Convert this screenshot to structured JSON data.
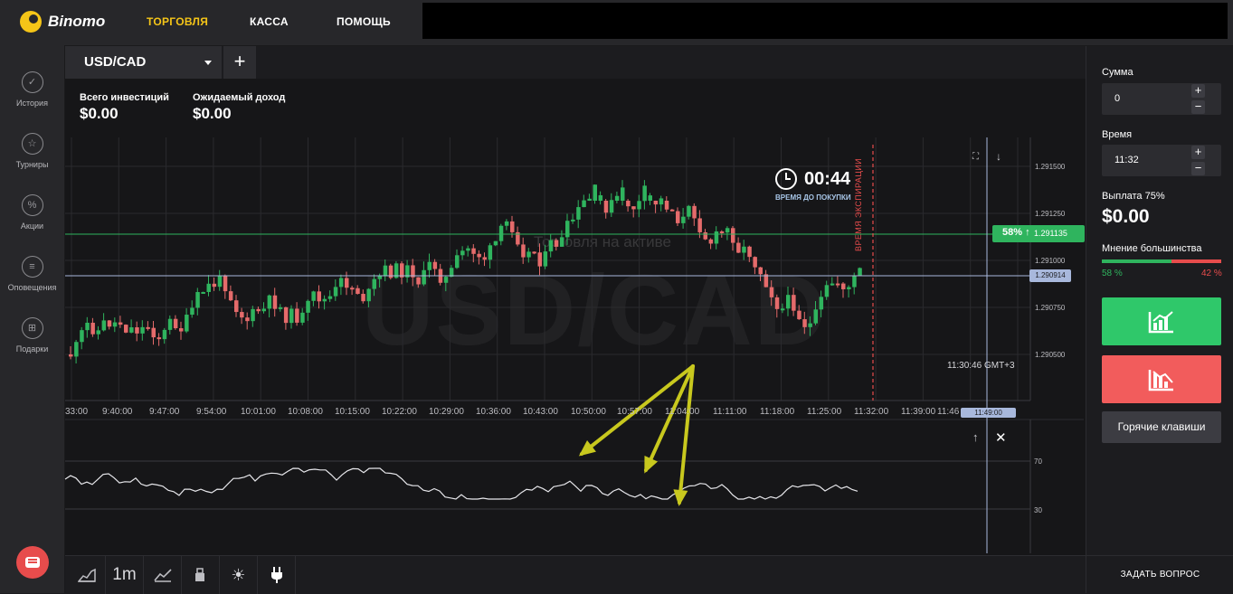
{
  "app": {
    "brand": "Binomo"
  },
  "nav": {
    "trade": "ТОРГОВЛЯ",
    "cash": "КАССА",
    "help": "ПОМОЩЬ"
  },
  "sidebar": {
    "items": [
      {
        "label": "История",
        "icon": "check-circle-icon"
      },
      {
        "label": "Турниры",
        "icon": "trophy-icon"
      },
      {
        "label": "Акции",
        "icon": "percent-icon"
      },
      {
        "label": "Оповещения",
        "icon": "list-icon"
      },
      {
        "label": "Подарки",
        "icon": "gift-icon"
      }
    ]
  },
  "tab": {
    "asset": "USD/CAD",
    "add": "+"
  },
  "stats": {
    "invest_label": "Всего инвестиций",
    "invest_value": "$0.00",
    "income_label": "Ожидаемый доход",
    "income_value": "$0.00"
  },
  "chart": {
    "timer": "00:44",
    "timer_label": "ВРЕМЯ ДО ПОКУПКИ",
    "expiry_label": "ВРЕМЯ ЭКСПИРАЦИИ",
    "watermark": "USD/CAD",
    "watermark_sub": "Торговля на активе",
    "percent_badge": "58% ↑",
    "percent_price": "1.291135",
    "current_price": "1.290914",
    "time_badge": "11:49:00",
    "clock": "11:30:46 GMT+3",
    "price_ticks": [
      "1.291500",
      "1.291250",
      "1.291000",
      "1.290750",
      "1.290500"
    ],
    "time_ticks": [
      "33:00",
      "9:40:00",
      "9:47:00",
      "9:54:00",
      "10:01:00",
      "10:08:00",
      "10:15:00",
      "10:22:00",
      "10:29:00",
      "10:36:00",
      "10:43:00",
      "10:50:00",
      "10:57:00",
      "11:04:00",
      "11:11:00",
      "11:18:00",
      "11:25:00",
      "11:32:00",
      "11:39:00",
      "11:46"
    ],
    "osc_ticks": [
      "70",
      "30"
    ],
    "colors": {
      "up": "#2fb45e",
      "down": "#e56b6b",
      "arrow": "#c8c81e"
    }
  },
  "toolbar": {
    "timeframe": "1m"
  },
  "panel": {
    "amount_label": "Сумма",
    "amount_value": "0",
    "time_label": "Время",
    "time_value": "11:32",
    "payout_label": "Выплата 75%",
    "payout_value": "$0.00",
    "majority_label": "Мнение большинства",
    "majority_up": "58 %",
    "majority_down": "42 %",
    "majority_up_fraction": 0.58,
    "hotkeys": "Горячие клавиши",
    "ask": "ЗАДАТЬ ВОПРОС"
  }
}
